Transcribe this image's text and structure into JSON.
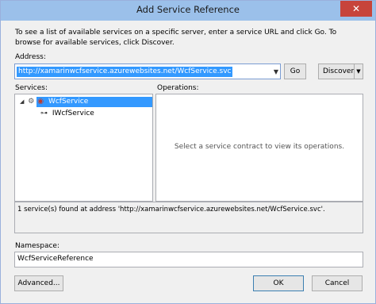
{
  "window": {
    "title": "Add Service Reference",
    "close_glyph": "✕"
  },
  "intro": "To see a list of available services on a specific server, enter a service URL and click Go. To browse for available services, click Discover.",
  "address": {
    "label": "Address:",
    "value": "http://xamarinwcfservice.azurewebsites.net/WcfService.svc",
    "go_label": "Go",
    "discover_label": "Discover"
  },
  "services": {
    "label": "Services:",
    "tree": [
      {
        "label": "WcfService",
        "selected": true,
        "icon": "service-icon"
      },
      {
        "label": "IWcfService",
        "selected": false,
        "icon": "interface-icon"
      }
    ]
  },
  "operations": {
    "label": "Operations:",
    "placeholder": "Select a service contract to view its operations."
  },
  "status_text": "1 service(s) found at address 'http://xamarinwcfservice.azurewebsites.net/WcfService.svc'.",
  "namespace": {
    "label": "Namespace:",
    "value": "WcfServiceReference"
  },
  "buttons": {
    "advanced": "Advanced...",
    "ok": "OK",
    "cancel": "Cancel"
  },
  "colors": {
    "titlebar": "#9bc0ea",
    "close": "#c7443b",
    "selection": "#3399ff"
  }
}
